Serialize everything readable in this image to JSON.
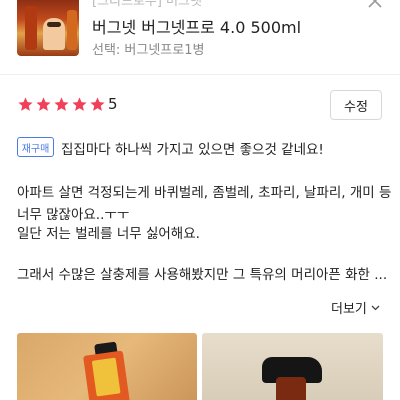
{
  "product": {
    "brand_line": "[그리드로우] 버그넷",
    "name": "버그넷 버그넷프로 4.0 500ml",
    "option": "선택: 버그넷프로1병"
  },
  "review": {
    "rating": "5",
    "stars_filled": 5,
    "edit_label": "수정",
    "rebuy_badge": "재구매",
    "lines": [
      "집집마다 하나씩 가지고 있으면 좋으것 같네요!",
      "아파트 살면 걱정되는게 바퀴벌레, 좀벌레, 초파리, 날파리, 개미 등",
      "너무 많잖아요..ㅜㅜ",
      "일단 저는 벌레를 너무 싫어해요.",
      "그래서 수많은 살충제를 사용해봤지만 그 특유의 머리아픈 화한 ..."
    ],
    "more_label": "더보기"
  },
  "icons": {
    "close": "close-icon",
    "star": "star-icon",
    "chevron": "chevron-down-icon"
  },
  "colors": {
    "star": "#f0405a",
    "badge": "#4b7be5"
  }
}
